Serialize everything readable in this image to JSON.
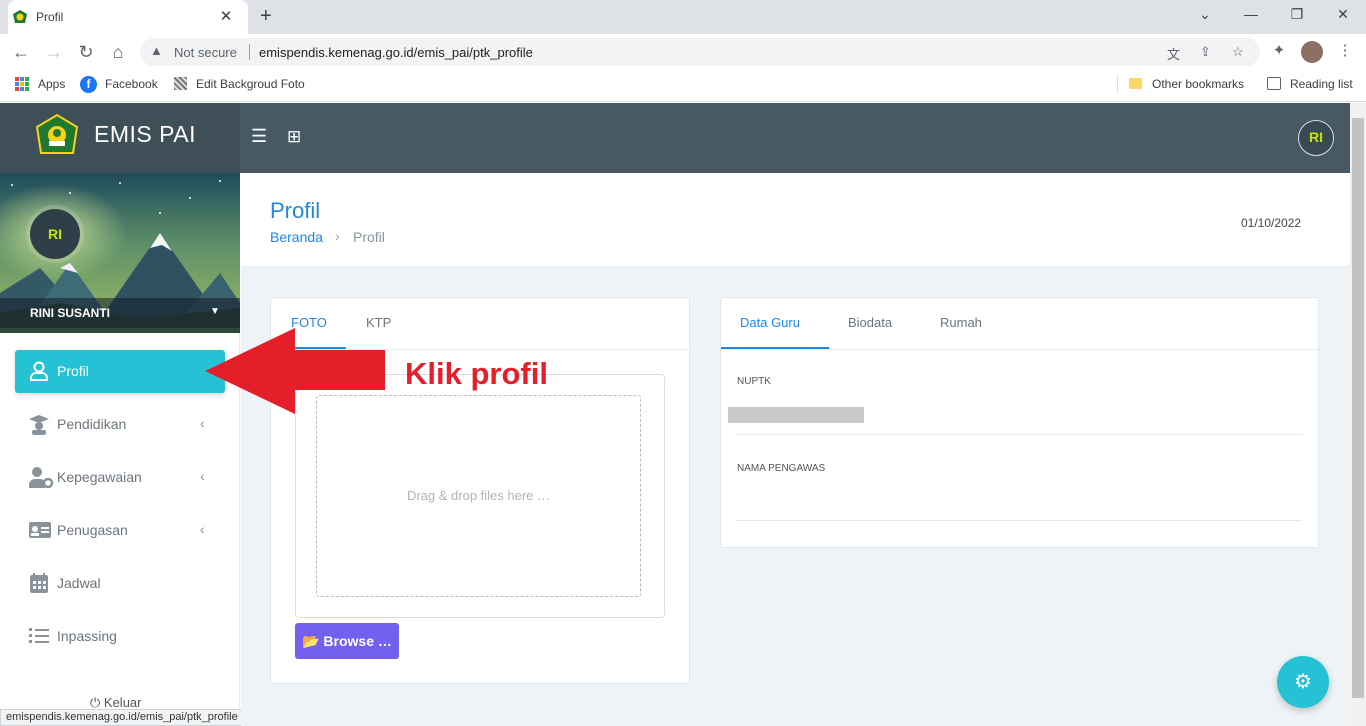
{
  "browser": {
    "tab_title": "Profil",
    "tab_close": "✕",
    "new_tab": "+",
    "window_controls": {
      "minimize": "⌄",
      "restore": "—",
      "maximize": "❐",
      "close": "✕"
    },
    "not_secure": "Not secure",
    "url": "emispendis.kemenag.go.id/emis_pai/ptk_profile",
    "bookmarks": {
      "apps": "Apps",
      "facebook": "Facebook",
      "edit_foto": "Edit Backgroud Foto",
      "other": "Other bookmarks",
      "reading_list": "Reading list"
    },
    "status_url": "emispendis.kemenag.go.id/emis_pai/ptk_profile"
  },
  "app": {
    "brand": "EMIS PAI",
    "user_initials": "RI",
    "accent_color": "#25c2d6",
    "header_color": "#475964"
  },
  "sidebar": {
    "user_initials": "RI",
    "user_name": "RINI SUSANTI",
    "items": [
      {
        "label": "Profil",
        "icon": "user-icon",
        "active": true
      },
      {
        "label": "Pendidikan",
        "icon": "graduate-icon",
        "expandable": true
      },
      {
        "label": "Kepegawaian",
        "icon": "user-gear-icon",
        "expandable": true
      },
      {
        "label": "Penugasan",
        "icon": "id-card-icon",
        "expandable": true
      },
      {
        "label": "Jadwal",
        "icon": "calendar-icon"
      },
      {
        "label": "Inpassing",
        "icon": "list-icon"
      }
    ],
    "logout": "Keluar"
  },
  "page": {
    "title": "Profil",
    "breadcrumb_home": "Beranda",
    "breadcrumb_current": "Profil",
    "date": "01/10/2022"
  },
  "photo_card": {
    "tabs": [
      "FOTO",
      "KTP"
    ],
    "drop_text": "Drag & drop files here …",
    "browse": "Browse …"
  },
  "data_card": {
    "tabs": [
      "Data Guru",
      "Biodata",
      "Rumah"
    ],
    "fields": [
      {
        "label": "NUPTK",
        "value": ""
      },
      {
        "label": "NAMA PENGAWAS",
        "value": ""
      }
    ]
  },
  "annotation": {
    "text": "Klik profil",
    "color": "#e41f2a"
  }
}
